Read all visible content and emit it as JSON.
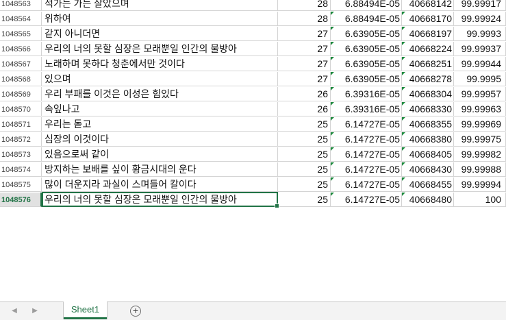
{
  "rows": [
    {
      "num": "1048563",
      "text": "석가는 가는 살았으며",
      "count": "28",
      "ratio": "6.88494E-05",
      "cum": "40668142",
      "pct": "99.99917"
    },
    {
      "num": "1048564",
      "text": " 위하여",
      "count": "28",
      "ratio": "6.88494E-05",
      "cum": "40668170",
      "pct": "99.99924"
    },
    {
      "num": "1048565",
      "text": " 같지 아니더면",
      "count": "27",
      "ratio": "6.63905E-05",
      "cum": "40668197",
      "pct": "99.9993"
    },
    {
      "num": "1048566",
      "text": " 우리의 너의 못할 심장은 모래뿐일 인간의 물방아",
      "count": "27",
      "ratio": "6.63905E-05",
      "cum": "40668224",
      "pct": "99.99937"
    },
    {
      "num": "1048567",
      "text": " 노래하며 못하다 청춘에서만 것이다",
      "count": "27",
      "ratio": "6.63905E-05",
      "cum": "40668251",
      "pct": "99.99944"
    },
    {
      "num": "1048568",
      "text": " 있으며",
      "count": "27",
      "ratio": "6.63905E-05",
      "cum": "40668278",
      "pct": "99.9995"
    },
    {
      "num": "1048569",
      "text": "우리 부패를 이것은 이성은 힘있다",
      "count": "26",
      "ratio": "6.39316E-05",
      "cum": "40668304",
      "pct": "99.99957"
    },
    {
      "num": "1048570",
      "text": "속잎나고",
      "count": "26",
      "ratio": "6.39316E-05",
      "cum": "40668330",
      "pct": "99.99963"
    },
    {
      "num": "1048571",
      "text": "우리는 돋고",
      "count": "25",
      "ratio": "6.14727E-05",
      "cum": "40668355",
      "pct": "99.99969"
    },
    {
      "num": "1048572",
      "text": " 심장의 이것이다",
      "count": "25",
      "ratio": "6.14727E-05",
      "cum": "40668380",
      "pct": "99.99975"
    },
    {
      "num": "1048573",
      "text": " 있음으로써 같이",
      "count": "25",
      "ratio": "6.14727E-05",
      "cum": "40668405",
      "pct": "99.99982"
    },
    {
      "num": "1048574",
      "text": " 방지하는 보배를 싶이 황금시대의 운다",
      "count": "25",
      "ratio": "6.14727E-05",
      "cum": "40668430",
      "pct": "99.99988"
    },
    {
      "num": "1048575",
      "text": " 많이 더운지라 과실이 스며들어 칼이다",
      "count": "25",
      "ratio": "6.14727E-05",
      "cum": "40668455",
      "pct": "99.99994"
    },
    {
      "num": "1048576",
      "text": " 우리의 너의 못할 심장은 모래뿐일 인간의 물방아",
      "count": "25",
      "ratio": "6.14727E-05",
      "cum": "40668480",
      "pct": "100"
    }
  ],
  "active_row": "1048576",
  "sheet_tab": "Sheet1",
  "nav_prev_icon": "◀",
  "nav_next_icon": "▶",
  "add_sheet_icon": "+",
  "accent_color": "#217346"
}
